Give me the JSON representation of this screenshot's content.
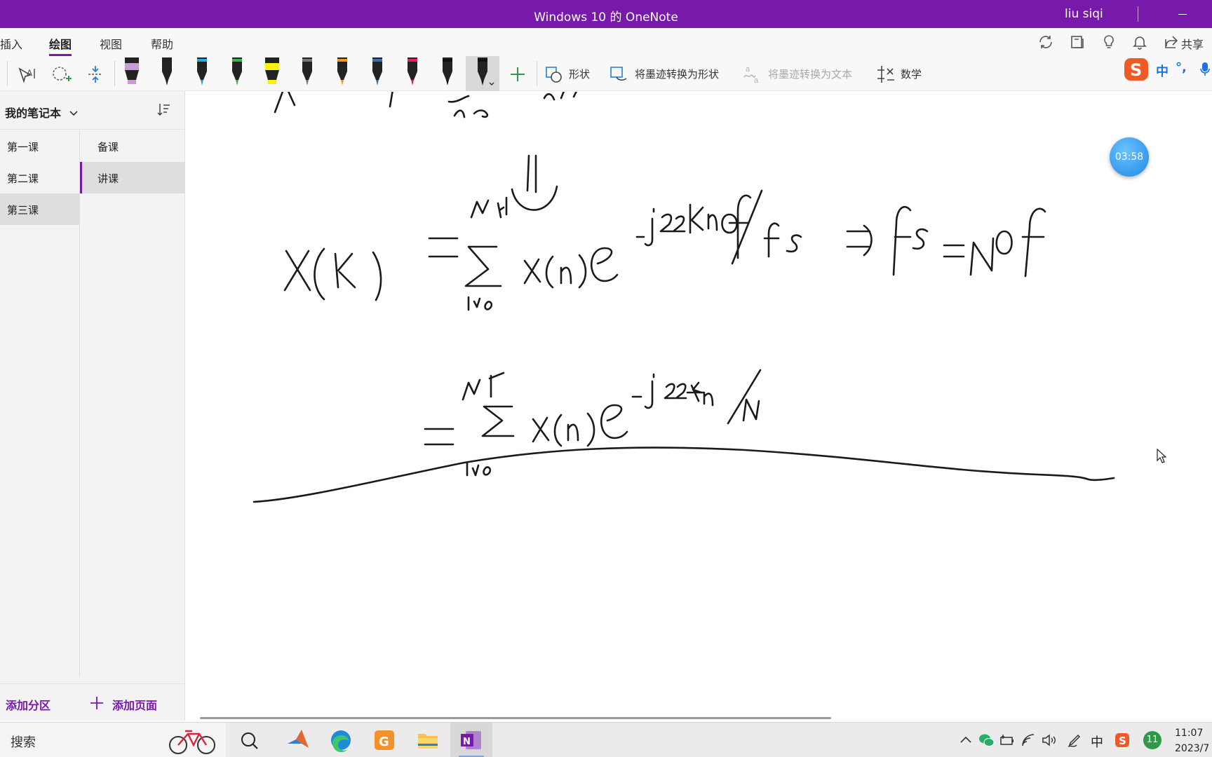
{
  "window": {
    "title": "Windows 10 的 OneNote",
    "user": "liu siqi"
  },
  "ribbon": {
    "tabs": [
      {
        "label": "插入",
        "active": false
      },
      {
        "label": "绘图",
        "active": true
      },
      {
        "label": "视图",
        "active": false
      },
      {
        "label": "帮助",
        "active": false
      }
    ],
    "share_label": "共享",
    "right_icons": [
      "sync-icon",
      "notebook-icon",
      "lightbulb-icon",
      "bell-icon",
      "share-icon"
    ]
  },
  "toolbar": {
    "tools": [
      "lasso-select-icon",
      "lasso-add-icon",
      "insert-space-icon"
    ],
    "pens": [
      {
        "name": "pen-purple-highlighter",
        "color": "#c79bd6"
      },
      {
        "name": "pen-black",
        "color": "#222222"
      },
      {
        "name": "pen-cyan",
        "color": "#29a9e1"
      },
      {
        "name": "pen-green",
        "color": "#39b54a"
      },
      {
        "name": "pen-yellow-highlighter",
        "color": "#fff200"
      },
      {
        "name": "pen-gray",
        "color": "#777777"
      },
      {
        "name": "pen-orange",
        "color": "#f7941d"
      },
      {
        "name": "pen-blue",
        "color": "#3a6fb0"
      },
      {
        "name": "pen-red",
        "color": "#ed1c5b"
      },
      {
        "name": "pen-black-2",
        "color": "#111111"
      },
      {
        "name": "pen-black-selected",
        "color": "#111111"
      }
    ],
    "shapes_label": "形状",
    "ink_to_shape_label": "将墨迹转换为形状",
    "ink_to_text_label": "将墨迹转换为文本",
    "math_label": "数学"
  },
  "ime": {
    "logo": "S",
    "mode": "中",
    "punct": "°,"
  },
  "nav": {
    "notebook": "我的笔记本",
    "sections": [
      {
        "label": "第一课",
        "selected": false
      },
      {
        "label": "第二课",
        "selected": false
      },
      {
        "label": "第三课",
        "selected": true
      }
    ],
    "pages": [
      {
        "label": "备课",
        "selected": false
      },
      {
        "label": "讲课",
        "selected": true
      }
    ],
    "add_section": "添加分区",
    "add_page": "添加页面"
  },
  "timer": "03:58",
  "taskbar": {
    "search_label": "搜索",
    "apps": [
      "search-app-icon",
      "matlab-icon",
      "edge-icon",
      "sogou-app-icon",
      "file-explorer-icon",
      "onenote-icon"
    ],
    "tray": {
      "ime_mode": "中",
      "badge": "11",
      "time": "11:07",
      "date": "2023/7"
    }
  }
}
